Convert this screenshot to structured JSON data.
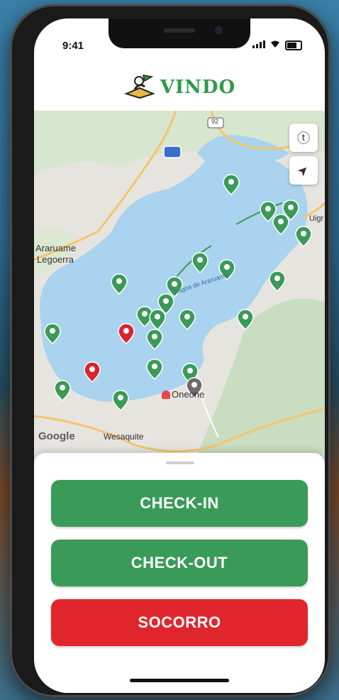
{
  "status_bar": {
    "time": "9:41",
    "signal": "…ıl",
    "wifi": "◔"
  },
  "header": {
    "app_name": "VINDO"
  },
  "map": {
    "labels": {
      "town_left": "Araruame",
      "town_left_2": "Legoerra",
      "road_sign": "92",
      "lake_text": "Lagoa de Araruama",
      "bottom_place": "Oneone",
      "bottom_place_2": "Wesaquite",
      "right_place": "Uigr",
      "attribution": "Google"
    },
    "controls": {
      "clock_icon": "ⓣ",
      "locate_icon": "➤"
    }
  },
  "actions": {
    "checkin_label": "CHECK-IN",
    "checkout_label": "CHECK-OUT",
    "socorro_label": "SOCORRO"
  },
  "colors": {
    "brand_green": "#2f9a48",
    "button_green": "#3a9a58",
    "danger_red": "#e0262c",
    "water": "#a9d3ee",
    "land": "#e6e4df"
  }
}
